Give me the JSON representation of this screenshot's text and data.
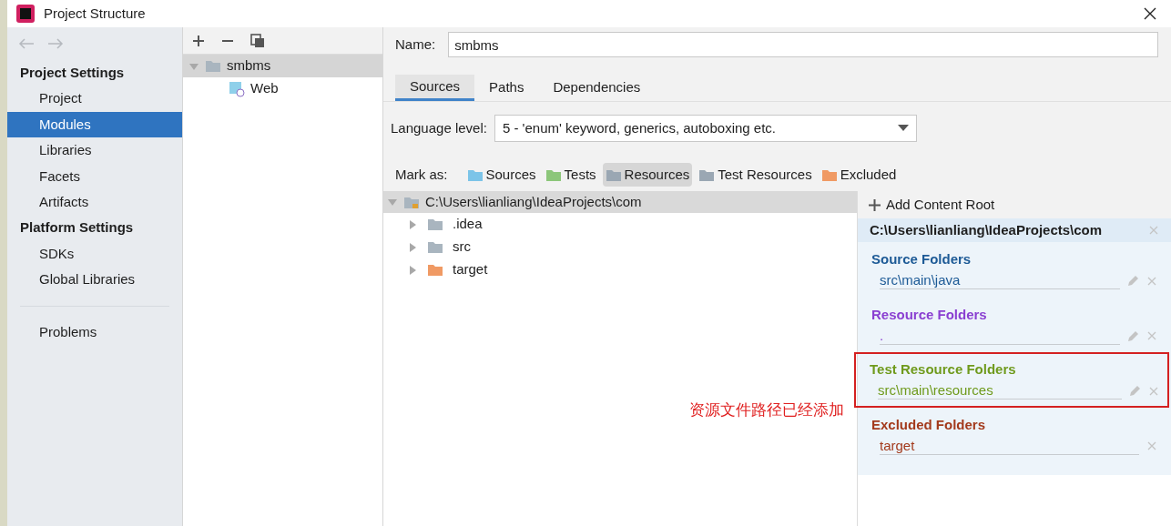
{
  "window": {
    "title": "Project Structure"
  },
  "sidebar": {
    "sections": [
      {
        "title": "Project Settings",
        "items": [
          {
            "label": "Project",
            "selected": false
          },
          {
            "label": "Modules",
            "selected": true
          },
          {
            "label": "Libraries",
            "selected": false
          },
          {
            "label": "Facets",
            "selected": false
          },
          {
            "label": "Artifacts",
            "selected": false
          }
        ]
      },
      {
        "title": "Platform Settings",
        "items": [
          {
            "label": "SDKs",
            "selected": false
          },
          {
            "label": "Global Libraries",
            "selected": false
          }
        ]
      },
      {
        "items": [
          {
            "label": "Problems",
            "selected": false
          }
        ]
      }
    ]
  },
  "module_tree": [
    {
      "label": "smbms",
      "expanded": true,
      "selected": true,
      "children": [
        {
          "label": "Web",
          "selected": false
        }
      ]
    }
  ],
  "name_field": {
    "label": "Name:",
    "value": "smbms"
  },
  "tabs": [
    {
      "label": "Sources",
      "selected": true
    },
    {
      "label": "Paths",
      "selected": false
    },
    {
      "label": "Dependencies",
      "selected": false
    }
  ],
  "language_level": {
    "label": "Language level:",
    "value": "5 - 'enum' keyword, generics, autoboxing etc."
  },
  "mark_as": {
    "label": "Mark as:",
    "buttons": [
      {
        "label": "Sources",
        "color": "#7cc4e8",
        "selected": false
      },
      {
        "label": "Tests",
        "color": "#8cc67a",
        "selected": false
      },
      {
        "label": "Resources",
        "color": "#9aa7b3",
        "selected": true
      },
      {
        "label": "Test Resources",
        "color": "#9aa7b3",
        "selected": false
      },
      {
        "label": "Excluded",
        "color": "#f09a64",
        "selected": false
      }
    ]
  },
  "file_tree": {
    "label": "C:\\Users\\lianliang\\IdeaProjects\\com",
    "expanded": true,
    "children": [
      {
        "label": ".idea",
        "color": "#a9b5bf",
        "expanded": false
      },
      {
        "label": "src",
        "color": "#a9b5bf",
        "expanded": false
      },
      {
        "label": "target",
        "color": "#f09a64",
        "expanded": false
      }
    ]
  },
  "content_roots": {
    "add_button": "Add Content Root",
    "root": "C:\\Users\\lianliang\\IdeaProjects\\com",
    "groups": [
      {
        "title": "Source Folders",
        "color": "#1d5a96",
        "highlighted": false,
        "entries": [
          {
            "path": "src\\main\\java",
            "editable": true
          }
        ]
      },
      {
        "title": "Resource Folders",
        "color": "#8a3fd1",
        "highlighted": false,
        "entries": [
          {
            "path": ".",
            "editable": true
          }
        ]
      },
      {
        "title": "Test Resource Folders",
        "color": "#6f9a1c",
        "highlighted": true,
        "entries": [
          {
            "path": "src\\main\\resources",
            "editable": true
          }
        ]
      },
      {
        "title": "Excluded Folders",
        "color": "#a33a1c",
        "highlighted": false,
        "entries": [
          {
            "path": "target",
            "editable": false
          }
        ]
      }
    ]
  },
  "annotation": "资源文件路径已经添加"
}
